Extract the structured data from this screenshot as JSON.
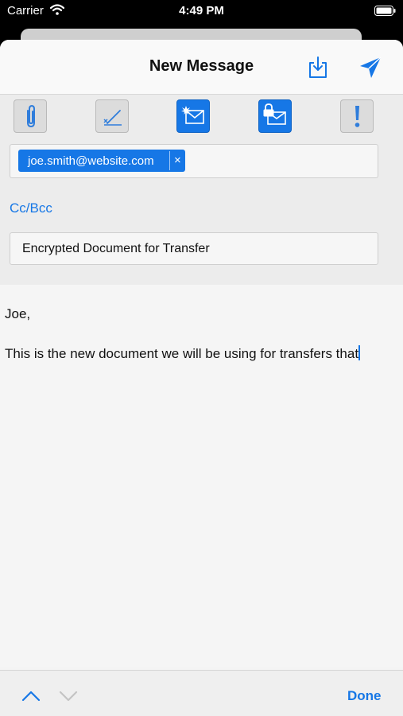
{
  "status_bar": {
    "carrier": "Carrier",
    "time": "4:49 PM"
  },
  "nav": {
    "title": "New Message",
    "save_icon": "save-to-tray-icon",
    "send_icon": "send-plane-icon"
  },
  "toolbar": {
    "items": [
      {
        "name": "attach",
        "icon": "paperclip-icon",
        "active": false
      },
      {
        "name": "signature",
        "icon": "signature-icon",
        "active": false
      },
      {
        "name": "sign-message",
        "icon": "signed-envelope-icon",
        "active": true
      },
      {
        "name": "encrypt-message",
        "icon": "locked-envelope-icon",
        "active": true
      },
      {
        "name": "priority",
        "icon": "exclamation-icon",
        "active": false
      }
    ]
  },
  "recipients": {
    "to": [
      "joe.smith@website.com"
    ],
    "remove_symbol": "×"
  },
  "cc_bcc_label": "Cc/Bcc",
  "subject": "Encrypted Document for Transfer",
  "body": {
    "line1": "Joe,",
    "line2": "This is the new document we will be using for transfers that"
  },
  "bottom_bar": {
    "done_label": "Done"
  },
  "colors": {
    "accent": "#1677e6",
    "toolbar_bg": "#ececec",
    "body_bg": "#f5f5f5"
  }
}
